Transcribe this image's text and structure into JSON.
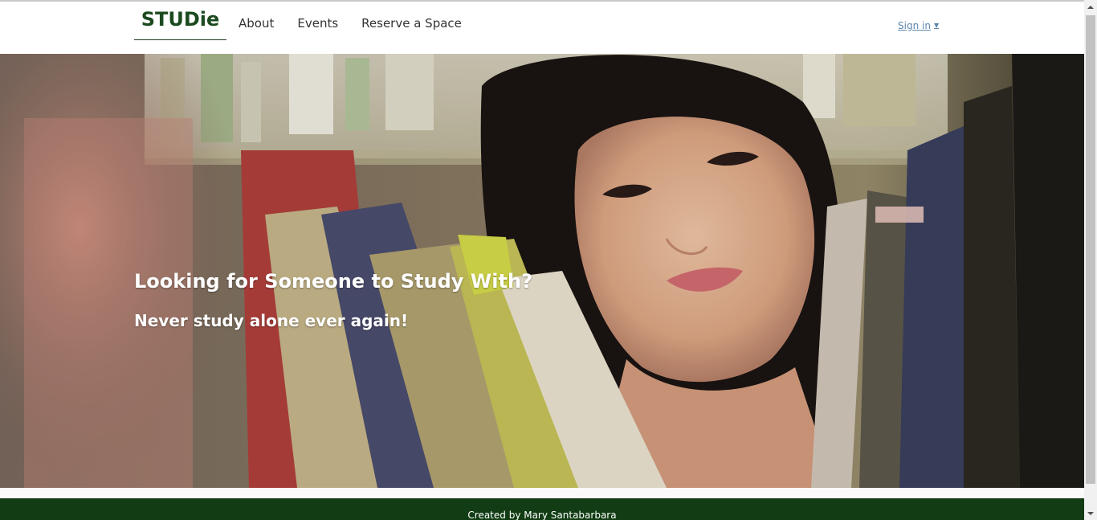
{
  "header": {
    "brand": "STUDie",
    "nav": [
      {
        "label": "About"
      },
      {
        "label": "Events"
      },
      {
        "label": "Reserve a Space"
      }
    ],
    "signin_label": "Sign in",
    "signin_caret_icon": "caret-down-icon"
  },
  "hero": {
    "title": "Looking for Someone to Study With?",
    "subtitle": "Never study alone ever again!",
    "image": "student-reading-in-library-photo"
  },
  "footer": {
    "credit": "Created by Mary Santabarbara"
  },
  "colors": {
    "brand": "#1b4a1f",
    "footer_bg": "#123d14",
    "link": "#5b87b0",
    "nav_text": "#333333"
  }
}
